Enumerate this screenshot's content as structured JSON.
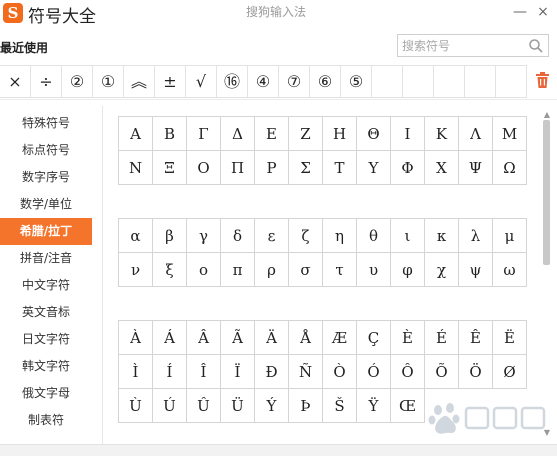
{
  "app": {
    "logo_glyph": "S",
    "title": "符号大全",
    "window_title": "搜狗输入法",
    "minimize_label": "—",
    "close_label": "×"
  },
  "recent": {
    "label": "最近使用",
    "search_placeholder": "搜索符号",
    "items": [
      "×",
      "÷",
      "②",
      "①",
      "︽",
      "±",
      "√",
      "⑯",
      "④",
      "⑦",
      "⑥",
      "⑤",
      "",
      "",
      "",
      "",
      ""
    ]
  },
  "sidebar": {
    "items": [
      {
        "label": "特殊符号",
        "active": false
      },
      {
        "label": "标点符号",
        "active": false
      },
      {
        "label": "数字序号",
        "active": false
      },
      {
        "label": "数学/单位",
        "active": false
      },
      {
        "label": "希腊/拉丁",
        "active": true
      },
      {
        "label": "拼音/注音",
        "active": false
      },
      {
        "label": "中文字符",
        "active": false
      },
      {
        "label": "英文音标",
        "active": false
      },
      {
        "label": "日文字符",
        "active": false
      },
      {
        "label": "韩文字符",
        "active": false
      },
      {
        "label": "俄文字母",
        "active": false
      },
      {
        "label": "制表符",
        "active": false
      }
    ]
  },
  "symbols": {
    "greek_upper": [
      "Α",
      "Β",
      "Γ",
      "Δ",
      "Ε",
      "Ζ",
      "Η",
      "Θ",
      "Ι",
      "Κ",
      "Λ",
      "Μ",
      "Ν",
      "Ξ",
      "Ο",
      "Π",
      "Ρ",
      "Σ",
      "Τ",
      "Υ",
      "Φ",
      "Χ",
      "Ψ",
      "Ω"
    ],
    "greek_lower": [
      "α",
      "β",
      "γ",
      "δ",
      "ε",
      "ζ",
      "η",
      "θ",
      "ι",
      "κ",
      "λ",
      "μ",
      "ν",
      "ξ",
      "ο",
      "π",
      "ρ",
      "σ",
      "τ",
      "υ",
      "φ",
      "χ",
      "ψ",
      "ω"
    ],
    "latin": [
      "À",
      "Á",
      "Â",
      "Ã",
      "Ä",
      "Å",
      "Æ",
      "Ç",
      "È",
      "É",
      "Ê",
      "Ë",
      "Ì",
      "Í",
      "Î",
      "Ï",
      "Ð",
      "Ñ",
      "Ò",
      "Ó",
      "Ô",
      "Õ",
      "Ö",
      "Ø",
      "Ù",
      "Ú",
      "Û",
      "Ü",
      "Ý",
      "Þ",
      "Š",
      "Ÿ",
      "Œ"
    ]
  },
  "icons": {
    "search": "search-icon",
    "trash": "trash-icon",
    "scroll_up": "▲",
    "scroll_down": "▼"
  },
  "colors": {
    "accent": "#f4742b",
    "logo": "#f26b1d",
    "trash": "#e8663a"
  }
}
